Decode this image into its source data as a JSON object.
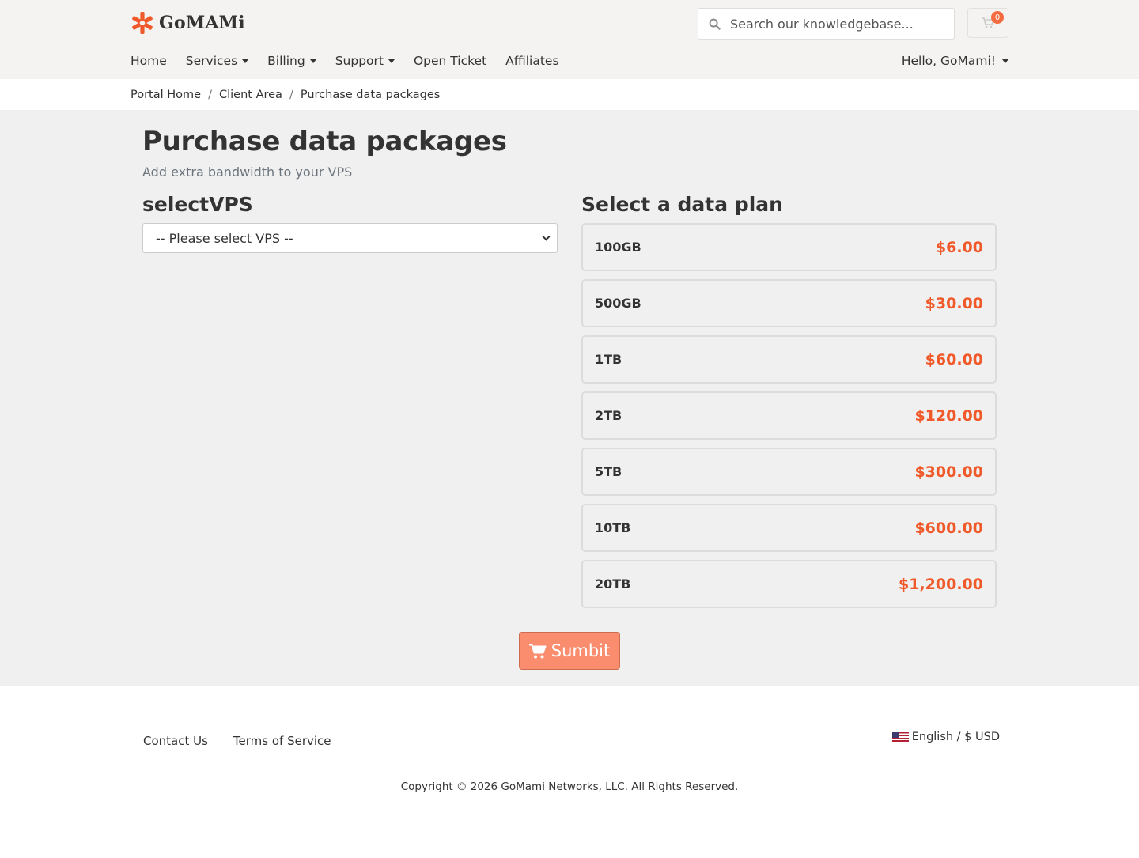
{
  "brand": {
    "name": "GoMAMi",
    "accent": "#f05a2b"
  },
  "header": {
    "search_placeholder": "Search our knowledgebase...",
    "cart_count": "0",
    "nav": [
      {
        "label": "Home",
        "dropdown": false
      },
      {
        "label": "Services",
        "dropdown": true
      },
      {
        "label": "Billing",
        "dropdown": true
      },
      {
        "label": "Support",
        "dropdown": true
      },
      {
        "label": "Open Ticket",
        "dropdown": false
      },
      {
        "label": "Affiliates",
        "dropdown": false
      }
    ],
    "user_menu": "Hello, GoMami!"
  },
  "breadcrumb": [
    "Portal Home",
    "Client Area",
    "Purchase data packages"
  ],
  "page": {
    "title": "Purchase data packages",
    "subtitle": "Add extra bandwidth to your VPS",
    "vps_heading": "selectVPS",
    "vps_select_value": "-- Please select VPS --",
    "plans_heading": "Select a data plan",
    "plans": [
      {
        "name": "100GB",
        "price": "$6.00"
      },
      {
        "name": "500GB",
        "price": "$30.00"
      },
      {
        "name": "1TB",
        "price": "$60.00"
      },
      {
        "name": "2TB",
        "price": "$120.00"
      },
      {
        "name": "5TB",
        "price": "$300.00"
      },
      {
        "name": "10TB",
        "price": "$600.00"
      },
      {
        "name": "20TB",
        "price": "$1,200.00"
      }
    ],
    "submit_label": "Sumbit",
    "submit_icon": "cart-icon"
  },
  "footer": {
    "links": [
      "Contact Us",
      "Terms of Service"
    ],
    "language": "English / $ USD",
    "copyright": "Copyright © 2026 GoMami Networks, LLC. All Rights Reserved."
  }
}
